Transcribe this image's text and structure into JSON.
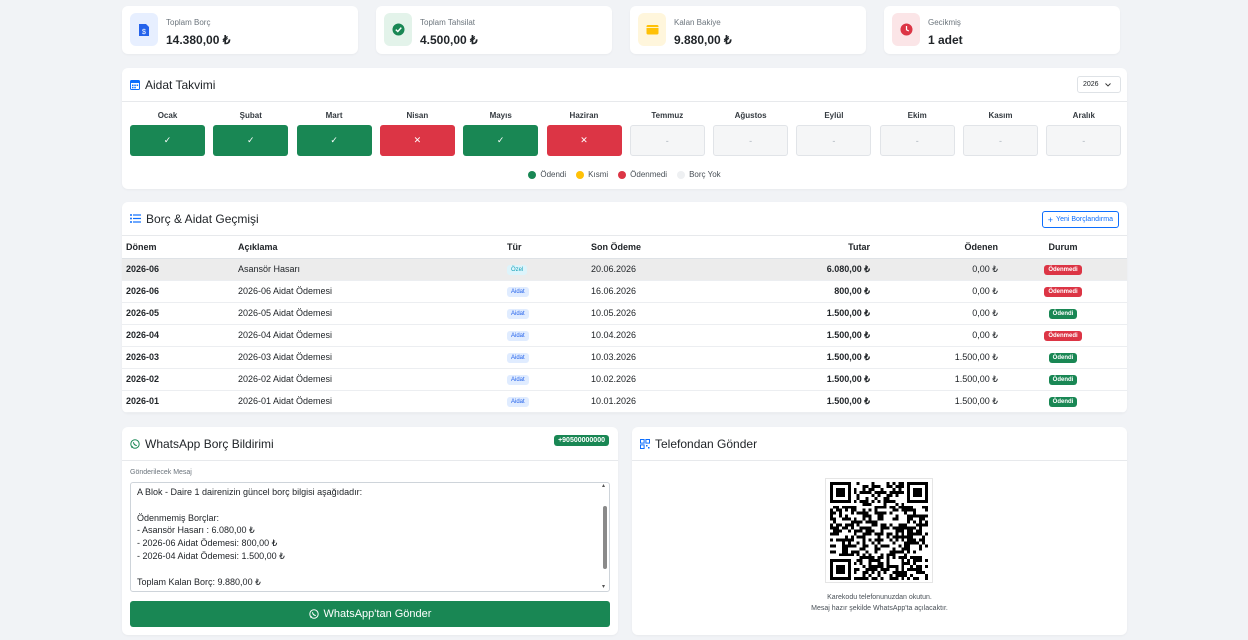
{
  "stats": [
    {
      "label": "Toplam Borç",
      "value": "14.380,00 ₺",
      "icon": "dollar-file-icon",
      "color": "#2563eb",
      "bg": "#e7efff"
    },
    {
      "label": "Toplam Tahsilat",
      "value": "4.500,00 ₺",
      "icon": "check-circle-icon",
      "color": "#198754",
      "bg": "#e3f3ea"
    },
    {
      "label": "Kalan Bakiye",
      "value": "9.880,00 ₺",
      "icon": "wallet-icon",
      "color": "#ffc107",
      "bg": "#fff6dc"
    },
    {
      "label": "Gecikmiş",
      "value": "1 adet",
      "icon": "clock-icon",
      "color": "#dc3545",
      "bg": "#fbe5e7"
    }
  ],
  "calendar": {
    "title": "Aidat Takvimi",
    "year": "2026",
    "months": [
      {
        "name": "Ocak",
        "status": "paid",
        "mark": "✓"
      },
      {
        "name": "Şubat",
        "status": "paid",
        "mark": "✓"
      },
      {
        "name": "Mart",
        "status": "paid",
        "mark": "✓"
      },
      {
        "name": "Nisan",
        "status": "unpaid",
        "mark": "✕"
      },
      {
        "name": "Mayıs",
        "status": "paid",
        "mark": "✓"
      },
      {
        "name": "Haziran",
        "status": "unpaid",
        "mark": "✕"
      },
      {
        "name": "Temmuz",
        "status": "none",
        "mark": "-"
      },
      {
        "name": "Ağustos",
        "status": "none",
        "mark": "-"
      },
      {
        "name": "Eylül",
        "status": "none",
        "mark": "-"
      },
      {
        "name": "Ekim",
        "status": "none",
        "mark": "-"
      },
      {
        "name": "Kasım",
        "status": "none",
        "mark": "-"
      },
      {
        "name": "Aralık",
        "status": "none",
        "mark": "-"
      }
    ],
    "legend": [
      {
        "label": "Ödendi",
        "color": "#198754"
      },
      {
        "label": "Kısmi",
        "color": "#ffc107"
      },
      {
        "label": "Ödenmedi",
        "color": "#dc3545"
      },
      {
        "label": "Borç Yok",
        "color": "#eef0f2"
      }
    ]
  },
  "history": {
    "title": "Borç & Aidat Geçmişi",
    "new_button": "Yeni Borçlandırma",
    "columns": {
      "period": "Dönem",
      "desc": "Açıklama",
      "type": "Tür",
      "last": "Son Ödeme",
      "amount": "Tutar",
      "paid": "Ödenen",
      "status": "Durum"
    },
    "rows": [
      {
        "period": "2026-06",
        "desc": "Asansör Hasarı",
        "type": "Özel",
        "last": "20.06.2026",
        "amount": "6.080,00 ₺",
        "paid": "0,00 ₺",
        "status": "Ödenmedi"
      },
      {
        "period": "2026-06",
        "desc": "2026-06 Aidat Ödemesi",
        "type": "Aidat",
        "last": "16.06.2026",
        "amount": "800,00 ₺",
        "paid": "0,00 ₺",
        "status": "Ödenmedi"
      },
      {
        "period": "2026-05",
        "desc": "2026-05 Aidat Ödemesi",
        "type": "Aidat",
        "last": "10.05.2026",
        "amount": "1.500,00 ₺",
        "paid": "0,00 ₺",
        "status": "Ödendi"
      },
      {
        "period": "2026-04",
        "desc": "2026-04 Aidat Ödemesi",
        "type": "Aidat",
        "last": "10.04.2026",
        "amount": "1.500,00 ₺",
        "paid": "0,00 ₺",
        "status": "Ödenmedi"
      },
      {
        "period": "2026-03",
        "desc": "2026-03 Aidat Ödemesi",
        "type": "Aidat",
        "last": "10.03.2026",
        "amount": "1.500,00 ₺",
        "paid": "1.500,00 ₺",
        "status": "Ödendi"
      },
      {
        "period": "2026-02",
        "desc": "2026-02 Aidat Ödemesi",
        "type": "Aidat",
        "last": "10.02.2026",
        "amount": "1.500,00 ₺",
        "paid": "1.500,00 ₺",
        "status": "Ödendi"
      },
      {
        "period": "2026-01",
        "desc": "2026-01 Aidat Ödemesi",
        "type": "Aidat",
        "last": "10.01.2026",
        "amount": "1.500,00 ₺",
        "paid": "1.500,00 ₺",
        "status": "Ödendi"
      }
    ]
  },
  "whatsapp": {
    "title": "WhatsApp Borç Bildirimi",
    "phone": "+90500000000",
    "message_label": "Gönderilecek Mesaj",
    "message": "A Blok - Daire 1 dairenizin güncel borç bilgisi aşağıdadır:\n\nÖdenmemiş Borçlar:\n- Asansör Hasarı : 6.080,00 ₺\n- 2026-06 Aidat Ödemesi: 800,00 ₺\n- 2026-04 Aidat Ödemesi: 1.500,00 ₺\n\nToplam Kalan Borç: 9.880,00 ₺",
    "send_button": "WhatsApp'tan Gönder"
  },
  "phone_send": {
    "title": "Telefondan Gönder",
    "hint1": "Karekodu telefonunuzdan okutun.",
    "hint2": "Mesaj hazır şekilde WhatsApp'ta açılacaktır."
  }
}
